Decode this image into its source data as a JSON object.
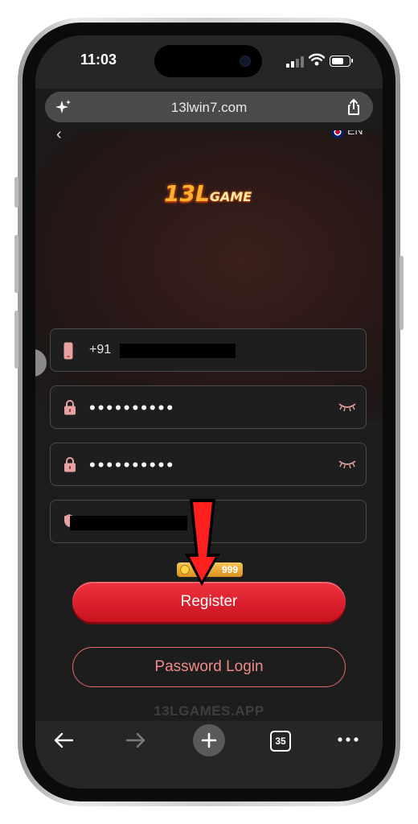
{
  "status_bar": {
    "time": "11:03"
  },
  "browser": {
    "url": "13lwin7.com",
    "tab_count": "35"
  },
  "header": {
    "language": "EN"
  },
  "logo": {
    "num": "13L",
    "word": "GAME"
  },
  "form": {
    "phone": {
      "prefix": "+91",
      "value": ""
    },
    "password": {
      "value": "••••••••••"
    },
    "confirm_password": {
      "value": "••••••••••"
    },
    "invite_code": {
      "value": ""
    }
  },
  "bonus": {
    "text": "999"
  },
  "buttons": {
    "register": "Register",
    "password_login": "Password Login"
  },
  "footer": {
    "domain": "13LGAMES.APP"
  },
  "colors": {
    "accent": "#e3202f",
    "background": "#1d1d1d",
    "outline": "#e36a6a"
  }
}
